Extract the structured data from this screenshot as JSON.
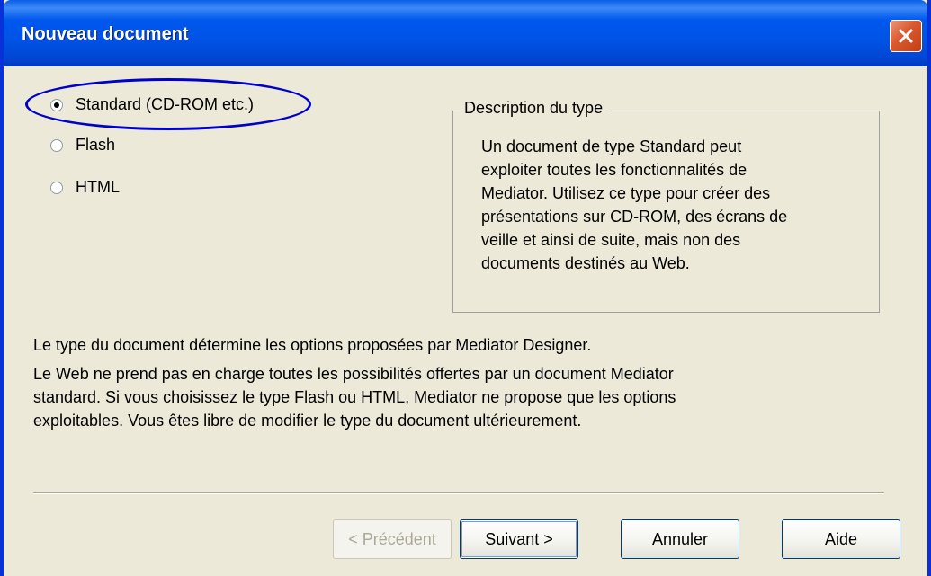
{
  "window": {
    "title": "Nouveau document"
  },
  "document_types": [
    {
      "label": "Standard (CD-ROM etc.)",
      "selected": true
    },
    {
      "label": "Flash",
      "selected": false
    },
    {
      "label": "HTML",
      "selected": false
    }
  ],
  "description_box": {
    "legend": "Description du type",
    "lines": [
      "Un document de type Standard peut",
      "exploiter toutes les fonctionnalités de",
      "Mediator. Utilisez ce type pour créer des",
      "présentations sur CD-ROM, des écrans de",
      "veille et ainsi de suite, mais non des",
      "documents destinés au Web."
    ]
  },
  "info": {
    "line1": "Le type du document détermine les options proposées par Mediator Designer.",
    "para2": [
      "Le Web ne prend pas en charge toutes les possibilités offertes par un document Mediator",
      "standard. Si vous choisissez le type Flash ou HTML, Mediator ne propose que les options",
      "exploitables. Vous êtes libre de modifier le type du document ultérieurement."
    ]
  },
  "buttons": {
    "previous": "< Précédent",
    "next": "Suivant >",
    "cancel": "Annuler",
    "help": "Aide"
  },
  "colors": {
    "titlebar": "#0058EE",
    "highlight_ellipse": "#0000CC",
    "close_button": "#D9582D"
  },
  "icons": {
    "close": "close-icon"
  }
}
